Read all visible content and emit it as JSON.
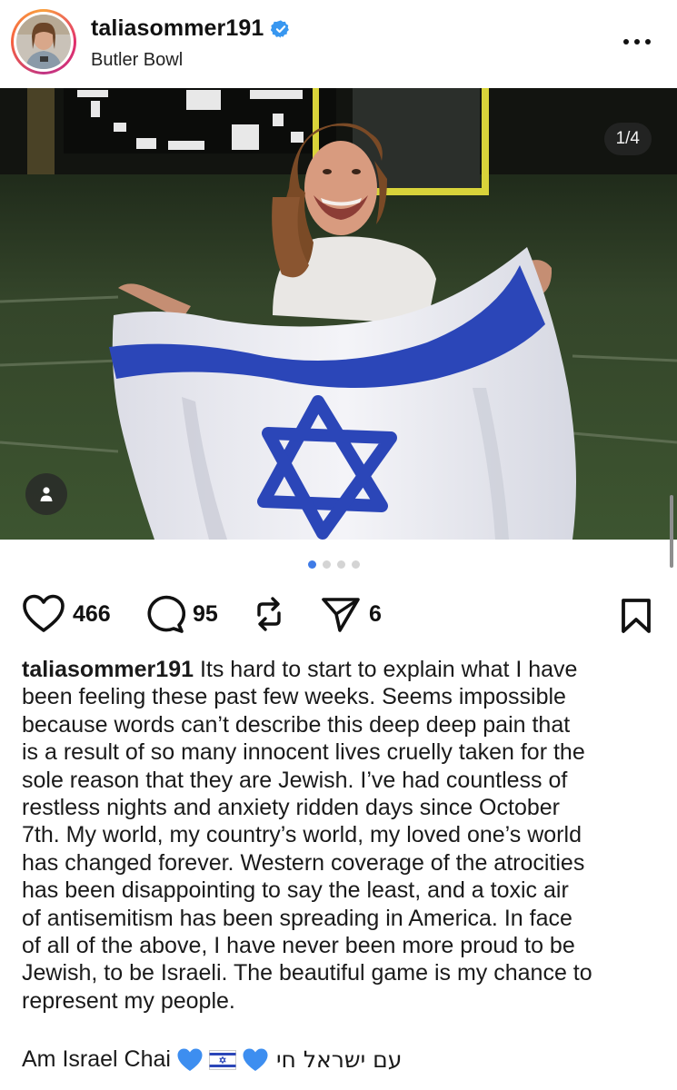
{
  "post": {
    "username": "taliasommer191",
    "location": "Butler Bowl",
    "verified": true,
    "image_counter": "1/4",
    "carousel": {
      "total": 4,
      "active_index": 0
    }
  },
  "actions": {
    "likes": "466",
    "comments": "95",
    "shares": "6"
  },
  "caption": {
    "username": "taliasommer191",
    "first_line_rest": " Its hard to start to explain what I have",
    "lines": [
      "been feeling these past few weeks. Seems impossible",
      "because words can’t describe this deep deep pain that",
      "is a result of so many innocent lives cruelly taken for the",
      "sole reason that they are Jewish. I’ve had countless of",
      "restless nights and anxiety ridden days since October",
      "7th. My world, my country’s world, my loved one’s world",
      "has changed forever. Western coverage of the atrocities",
      "has been disappointing to say the least, and a toxic air",
      "of antisemitism has been spreading in America. In face",
      "of all of the above, I have never been more proud to be",
      "Jewish, to be Israeli. The beautiful game is my chance to",
      "represent my people."
    ],
    "closing_text": "Am Israel Chai",
    "closing_hebrew": "עם ישראל חי"
  },
  "icons": {
    "verified": "verified-badge-icon",
    "more": "more-options-icon",
    "like": "heart-icon",
    "comment": "comment-bubble-icon",
    "repost": "repost-icon",
    "share": "send-icon",
    "save": "bookmark-icon",
    "user_tag": "person-icon"
  },
  "colors": {
    "verified_blue": "#3897f0",
    "active_dot": "#3f7be6",
    "flag_blue": "#2b46b8"
  }
}
